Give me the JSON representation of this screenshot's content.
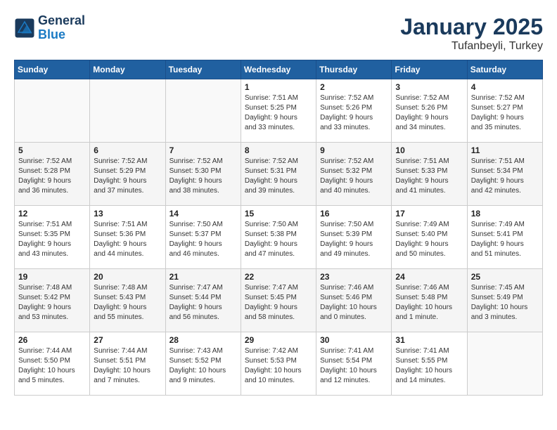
{
  "header": {
    "logo_line1": "General",
    "logo_line2": "Blue",
    "month": "January 2025",
    "location": "Tufanbeyli, Turkey"
  },
  "weekdays": [
    "Sunday",
    "Monday",
    "Tuesday",
    "Wednesday",
    "Thursday",
    "Friday",
    "Saturday"
  ],
  "weeks": [
    [
      {
        "day": "",
        "info": ""
      },
      {
        "day": "",
        "info": ""
      },
      {
        "day": "",
        "info": ""
      },
      {
        "day": "1",
        "info": "Sunrise: 7:51 AM\nSunset: 5:25 PM\nDaylight: 9 hours\nand 33 minutes."
      },
      {
        "day": "2",
        "info": "Sunrise: 7:52 AM\nSunset: 5:26 PM\nDaylight: 9 hours\nand 33 minutes."
      },
      {
        "day": "3",
        "info": "Sunrise: 7:52 AM\nSunset: 5:26 PM\nDaylight: 9 hours\nand 34 minutes."
      },
      {
        "day": "4",
        "info": "Sunrise: 7:52 AM\nSunset: 5:27 PM\nDaylight: 9 hours\nand 35 minutes."
      }
    ],
    [
      {
        "day": "5",
        "info": "Sunrise: 7:52 AM\nSunset: 5:28 PM\nDaylight: 9 hours\nand 36 minutes."
      },
      {
        "day": "6",
        "info": "Sunrise: 7:52 AM\nSunset: 5:29 PM\nDaylight: 9 hours\nand 37 minutes."
      },
      {
        "day": "7",
        "info": "Sunrise: 7:52 AM\nSunset: 5:30 PM\nDaylight: 9 hours\nand 38 minutes."
      },
      {
        "day": "8",
        "info": "Sunrise: 7:52 AM\nSunset: 5:31 PM\nDaylight: 9 hours\nand 39 minutes."
      },
      {
        "day": "9",
        "info": "Sunrise: 7:52 AM\nSunset: 5:32 PM\nDaylight: 9 hours\nand 40 minutes."
      },
      {
        "day": "10",
        "info": "Sunrise: 7:51 AM\nSunset: 5:33 PM\nDaylight: 9 hours\nand 41 minutes."
      },
      {
        "day": "11",
        "info": "Sunrise: 7:51 AM\nSunset: 5:34 PM\nDaylight: 9 hours\nand 42 minutes."
      }
    ],
    [
      {
        "day": "12",
        "info": "Sunrise: 7:51 AM\nSunset: 5:35 PM\nDaylight: 9 hours\nand 43 minutes."
      },
      {
        "day": "13",
        "info": "Sunrise: 7:51 AM\nSunset: 5:36 PM\nDaylight: 9 hours\nand 44 minutes."
      },
      {
        "day": "14",
        "info": "Sunrise: 7:50 AM\nSunset: 5:37 PM\nDaylight: 9 hours\nand 46 minutes."
      },
      {
        "day": "15",
        "info": "Sunrise: 7:50 AM\nSunset: 5:38 PM\nDaylight: 9 hours\nand 47 minutes."
      },
      {
        "day": "16",
        "info": "Sunrise: 7:50 AM\nSunset: 5:39 PM\nDaylight: 9 hours\nand 49 minutes."
      },
      {
        "day": "17",
        "info": "Sunrise: 7:49 AM\nSunset: 5:40 PM\nDaylight: 9 hours\nand 50 minutes."
      },
      {
        "day": "18",
        "info": "Sunrise: 7:49 AM\nSunset: 5:41 PM\nDaylight: 9 hours\nand 51 minutes."
      }
    ],
    [
      {
        "day": "19",
        "info": "Sunrise: 7:48 AM\nSunset: 5:42 PM\nDaylight: 9 hours\nand 53 minutes."
      },
      {
        "day": "20",
        "info": "Sunrise: 7:48 AM\nSunset: 5:43 PM\nDaylight: 9 hours\nand 55 minutes."
      },
      {
        "day": "21",
        "info": "Sunrise: 7:47 AM\nSunset: 5:44 PM\nDaylight: 9 hours\nand 56 minutes."
      },
      {
        "day": "22",
        "info": "Sunrise: 7:47 AM\nSunset: 5:45 PM\nDaylight: 9 hours\nand 58 minutes."
      },
      {
        "day": "23",
        "info": "Sunrise: 7:46 AM\nSunset: 5:46 PM\nDaylight: 10 hours\nand 0 minutes."
      },
      {
        "day": "24",
        "info": "Sunrise: 7:46 AM\nSunset: 5:48 PM\nDaylight: 10 hours\nand 1 minute."
      },
      {
        "day": "25",
        "info": "Sunrise: 7:45 AM\nSunset: 5:49 PM\nDaylight: 10 hours\nand 3 minutes."
      }
    ],
    [
      {
        "day": "26",
        "info": "Sunrise: 7:44 AM\nSunset: 5:50 PM\nDaylight: 10 hours\nand 5 minutes."
      },
      {
        "day": "27",
        "info": "Sunrise: 7:44 AM\nSunset: 5:51 PM\nDaylight: 10 hours\nand 7 minutes."
      },
      {
        "day": "28",
        "info": "Sunrise: 7:43 AM\nSunset: 5:52 PM\nDaylight: 10 hours\nand 9 minutes."
      },
      {
        "day": "29",
        "info": "Sunrise: 7:42 AM\nSunset: 5:53 PM\nDaylight: 10 hours\nand 10 minutes."
      },
      {
        "day": "30",
        "info": "Sunrise: 7:41 AM\nSunset: 5:54 PM\nDaylight: 10 hours\nand 12 minutes."
      },
      {
        "day": "31",
        "info": "Sunrise: 7:41 AM\nSunset: 5:55 PM\nDaylight: 10 hours\nand 14 minutes."
      },
      {
        "day": "",
        "info": ""
      }
    ]
  ]
}
